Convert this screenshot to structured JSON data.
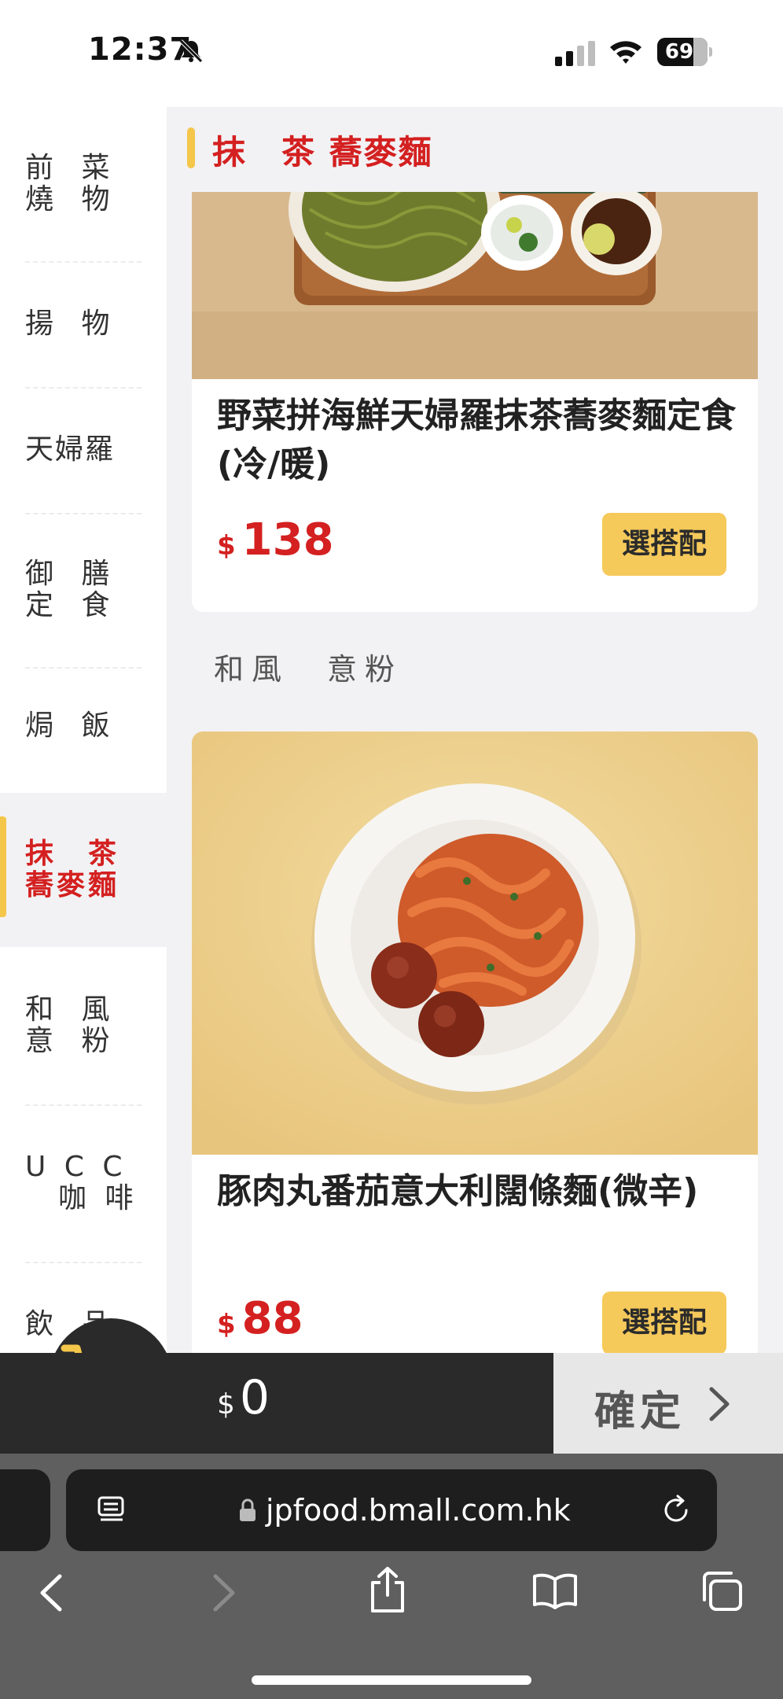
{
  "status": {
    "time": "12:37",
    "battery": "69"
  },
  "sidebar": {
    "items": [
      {
        "label": "前 菜\n燒 物"
      },
      {
        "label": "揚 物"
      },
      {
        "label": "天婦羅"
      },
      {
        "label": "御 膳\n定 食"
      },
      {
        "label": "焗 飯"
      },
      {
        "label": "抹　茶\n蕎麥麵"
      },
      {
        "label": "和 風\n意 粉"
      },
      {
        "label": "U C C\n　咖 啡"
      },
      {
        "label": "飲 品"
      }
    ]
  },
  "section": {
    "title": "抹　茶 蕎麥麵",
    "next_label": "和風　意粉"
  },
  "cards": [
    {
      "name": "野菜拼海鮮天婦羅抹茶蕎麥麵定食(冷/暖)",
      "currency": "$",
      "price": "138",
      "button": "選搭配"
    },
    {
      "name": "豚肉丸番茄意大利闊條麵(微辛)",
      "currency": "$",
      "price": "88",
      "button": "選搭配"
    }
  ],
  "cart": {
    "currency": "$",
    "total": "0",
    "confirm_label": "確定"
  },
  "browser": {
    "url": "jpfood.bmall.com.hk"
  },
  "colors": {
    "accent_red": "#d42020",
    "accent_yellow": "#f4c64a"
  }
}
